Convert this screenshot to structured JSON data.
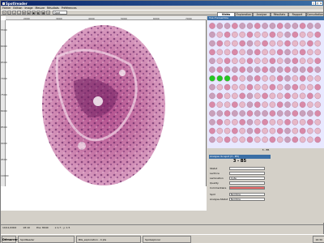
{
  "window": {
    "title": "Spotlreader"
  },
  "menu": [
    "Fichier",
    "Edition",
    "Image",
    "Mesure",
    "Résultats",
    "Préférences"
  ],
  "toolbar": {
    "select": "Spot"
  },
  "tabs": [
    "Vidéo",
    "Exploration",
    "Analyse",
    "Résultats",
    "Rapport",
    "Consultation"
  ],
  "viewer": {
    "ruler_top": [
      "2000",
      "3000",
      "4000",
      "5000",
      "6000",
      "7000"
    ],
    "ruler_left": [
      "5500",
      "6000",
      "6500",
      "7000",
      "7500",
      "8000",
      "8500",
      "9000",
      "9500",
      "10000"
    ]
  },
  "plate": {
    "title": "Vue d'ensemble",
    "status": "3 - B5"
  },
  "analysis": {
    "title": "Analyse du spot (3 - B5)",
    "spot_id": "3 - B5",
    "fields": [
      {
        "label": "Statut",
        "value": ""
      },
      {
        "label": "Lectrice",
        "value": ""
      },
      {
        "label": "Lamination",
        "value": "Cyte"
      },
      {
        "label": "Quality",
        "value": ""
      },
      {
        "label": "Commentaire",
        "value": ""
      },
      {
        "label": "Spot",
        "value": "Nombre"
      },
      {
        "label": "Analyse-Statut",
        "value": "Nombre"
      }
    ]
  },
  "status": {
    "date": "10/11/2002",
    "time": "18:10",
    "pos": "Pos: 8940",
    "zoom": "x:1,7 ; y: 1.5"
  },
  "taskbar": {
    "start": "Démarrer",
    "items": [
      "SpotReader",
      "BIG_exploration - 4 pts",
      "Spotexplorer"
    ],
    "clock": "16:30"
  }
}
